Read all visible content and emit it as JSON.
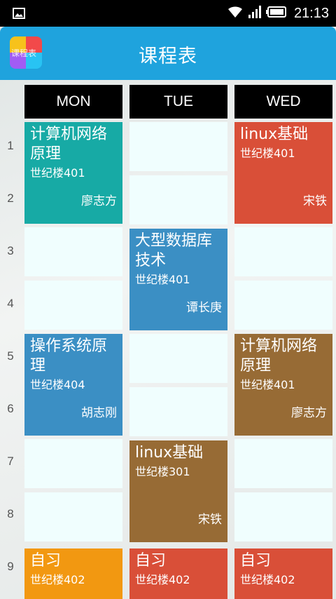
{
  "status_bar": {
    "time": "21:13",
    "icons": [
      "image-icon",
      "wifi-icon",
      "signal-icon",
      "battery-icon"
    ]
  },
  "app_bar": {
    "title": "课程表",
    "icon_text": "课程表"
  },
  "days": [
    "MON",
    "TUE",
    "WED"
  ],
  "periods": [
    "1",
    "2",
    "3",
    "4",
    "5",
    "6",
    "7",
    "8",
    "9"
  ],
  "colors": {
    "app_bar": "#1fa3dd",
    "teal": "#17aaa5",
    "red": "#d94f38",
    "blue": "#3b8fc4",
    "brown": "#976b35",
    "orange": "#f29811",
    "empty_cell": "#f0fefe"
  },
  "courses": {
    "mon_1": {
      "name": "计算机网络原理",
      "room": "世纪楼401",
      "teacher": "廖志方",
      "color": "#17aaa5"
    },
    "mon_5": {
      "name": "操作系统原理",
      "room": "世纪楼404",
      "teacher": "胡志刚",
      "color": "#3b8fc4"
    },
    "mon_9": {
      "name": "自习",
      "room": "世纪楼402",
      "color": "#f29811"
    },
    "tue_3": {
      "name": "大型数据库技术",
      "room": "世纪楼401",
      "teacher": "谭长庚",
      "color": "#3b8fc4"
    },
    "tue_7": {
      "name": "linux基础",
      "room": "世纪楼301",
      "teacher": "宋铁",
      "color": "#976b35"
    },
    "tue_9": {
      "name": "自习",
      "room": "世纪楼402",
      "color": "#d94f38"
    },
    "wed_1": {
      "name": "linux基础",
      "room": "世纪楼401",
      "teacher": "宋铁",
      "color": "#d94f38"
    },
    "wed_5": {
      "name": "计算机网络原理",
      "room": "世纪楼401",
      "teacher": "廖志方",
      "color": "#976b35"
    },
    "wed_9": {
      "name": "自习",
      "room": "世纪楼402",
      "color": "#d94f38"
    }
  }
}
